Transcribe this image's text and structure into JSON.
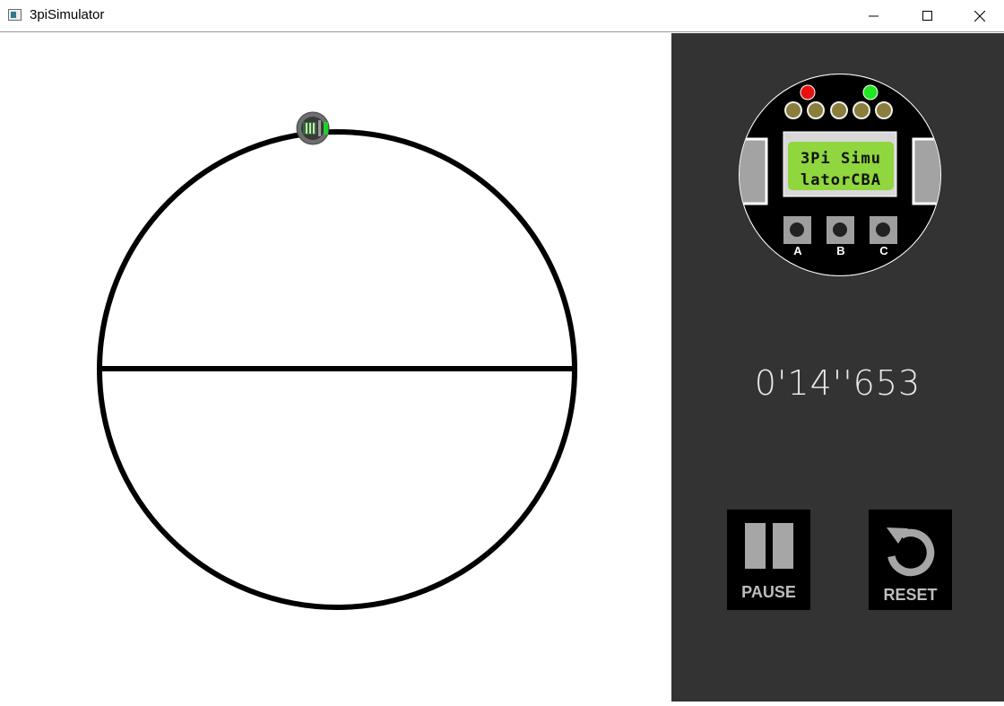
{
  "window": {
    "title": "3piSimulator",
    "minimize_icon": "minimize-icon",
    "maximize_icon": "maximize-icon",
    "close_icon": "close-icon"
  },
  "robot_panel": {
    "lcd_line1": "3Pi Simu",
    "lcd_line2": "latorCBA",
    "leds": {
      "left": "red",
      "right": "green"
    },
    "buttons": [
      "A",
      "B",
      "C"
    ]
  },
  "timer": {
    "text": "0'14''653"
  },
  "controls": {
    "pause_label": "PAUSE",
    "reset_label": "RESET"
  },
  "colors": {
    "panel_bg": "#323332",
    "track_line": "#000000",
    "lcd_green": "#8fd63f",
    "led_red": "#e81010",
    "led_green": "#22e622"
  }
}
